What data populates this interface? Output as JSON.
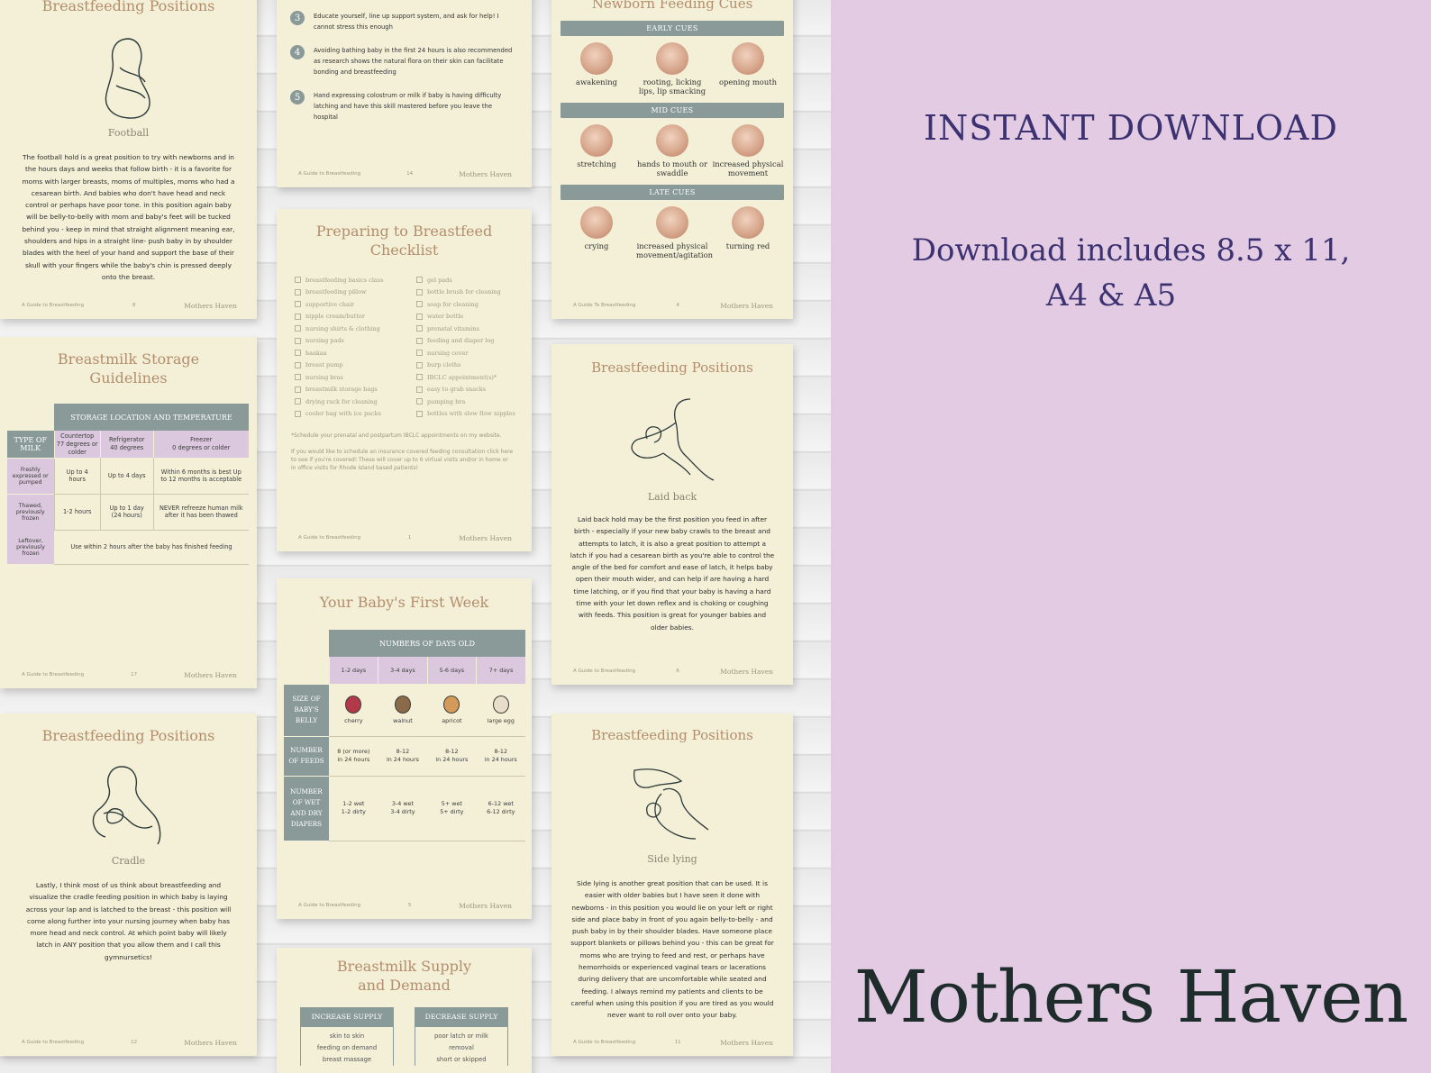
{
  "side_panel": {
    "heading": "INSTANT DOWNLOAD",
    "includes_line1": "Download includes 8.5 x 11,",
    "includes_line2": "A4 & A5",
    "brand": "Mothers Haven",
    "background_color": "#e3cce3",
    "heading_color": "#3c3272"
  },
  "footer_common": {
    "left": "A Guide to Breastfeeding",
    "left_alt": "A Guide To Breastfeeding",
    "brand": "Mothers Haven"
  },
  "football": {
    "title": "Breastfeeding Positions",
    "position_name": "Football",
    "description": "The football hold is a great position to try with newborns and in the hours days and weeks that follow birth - it is a favorite for moms with larger breasts, moms of multiples, moms who had a cesarean birth. And babies who don't have head and neck control or perhaps have poor tone. in this position again baby will be belly-to-belly with mom and baby's feet will be tucked behind you - keep in mind that straight alignment meaning ear, shoulders and hips in a straight line- push baby in by shoulder blades with the heel of your hand and support the base of their skull with your fingers while the baby's chin is pressed deeply onto the breast.",
    "page_number": "8"
  },
  "steps_page": {
    "steps": [
      {
        "n": "3",
        "text": "Educate yourself, line up support system, and ask for help! I cannot stress this enough"
      },
      {
        "n": "4",
        "text": "Avoiding bathing baby in the first 24 hours is also recommended as research shows the natural flora on their skin can facilitate bonding and breastfeeding"
      },
      {
        "n": "5",
        "text": "Hand expressing colostrum or milk if baby is having difficulty latching and have this skill mastered before you leave the hospital"
      }
    ],
    "page_number": "14"
  },
  "feeding_cues": {
    "title": "Newborn Feeding Cues",
    "groups": [
      {
        "band": "EARLY CUES",
        "cues": [
          "awakening",
          "rooting, licking lips, lip smacking",
          "opening mouth"
        ]
      },
      {
        "band": "MID CUES",
        "cues": [
          "stretching",
          "hands to mouth or swaddle",
          "increased physical movement"
        ]
      },
      {
        "band": "LATE CUES",
        "cues": [
          "crying",
          "increased physical movement/agitation",
          "turning red"
        ]
      }
    ],
    "page_number": "4"
  },
  "storage": {
    "title_line1": "Breastmilk Storage",
    "title_line2": "Guidelines",
    "group_header": "STORAGE LOCATION AND TEMPERATURE",
    "corner": "TYPE OF MILK",
    "columns": [
      {
        "name": "Countertop",
        "temp": "77 degrees or colder"
      },
      {
        "name": "Refrigerator",
        "temp": "40 degrees"
      },
      {
        "name": "Freezer",
        "temp": "0 degrees or colder"
      }
    ],
    "rows": [
      {
        "type": "Freshly expressed or pumped",
        "cells": [
          "Up to 4 hours",
          "Up to 4 days",
          "Within 6 months is best Up to 12 months is acceptable"
        ]
      },
      {
        "type": "Thawed, previously frozen",
        "cells": [
          "1-2 hours",
          "Up to 1 day (24 hours)",
          "NEVER refreeze human milk after it has been thawed"
        ]
      }
    ],
    "leftover_type": "Leftover, previously frozen",
    "leftover_text": "Use within 2 hours after the baby has finished feeding",
    "page_number": "17"
  },
  "checklist": {
    "title_line1": "Preparing to Breastfeed",
    "title_line2": "Checklist",
    "left_items": [
      "breastfeeding basics class",
      "breastfeeding pillow",
      "supportive chair",
      "nipple cream/butter",
      "nursing shirts & clothing",
      "nursing pads",
      "haakaa",
      "breast pump",
      "nursing bras",
      "breastmilk storage bags",
      "drying rack for cleaning",
      "cooler bag with ice packs"
    ],
    "right_items": [
      "gel pads",
      "bottle brush for cleaning",
      "soap for cleaning",
      "water bottle",
      "prenatal vitamins",
      "feeding and diaper log",
      "nursing cover",
      "burp cloths",
      "IBCLC appointment(s)*",
      "easy to grab snacks",
      "pumping bra",
      "bottles with slow flow nipples"
    ],
    "note1": "*Schedule your prenatal and postpartum IBCLC appointments on my website.",
    "note2": "If you would like to schedule an insurance covered feeding consultation click here to see if you're covered! These will cover up to 6 virtual visits and/or in home or in office visits for Rhode Island based patients!",
    "page_number": "1"
  },
  "laid_back": {
    "title": "Breastfeeding Positions",
    "position_name": "Laid back",
    "description": "Laid back hold may be the first position you feed in after birth - especially if your new baby crawls to the breast and attempts to latch, it is also a great position to attempt a latch if you had a cesarean birth as you're able to control the angle of the bed for comfort and ease of latch, it helps baby open their mouth wider, and can help if are having a hard time latching, or if you find that your baby is having a hard time with your let down reflex and is choking or coughing with feeds. This position is great for younger babies and older babies.",
    "page_number": "6"
  },
  "first_week": {
    "title": "Your Baby's First Week",
    "group_header": "NUMBERS OF DAYS OLD",
    "days": [
      "1-2 days",
      "3-4 days",
      "5-6 days",
      "7+ days"
    ],
    "row_labels": [
      "SIZE OF BABY'S BELLY",
      "NUMBER OF FEEDS",
      "NUMBER OF WET AND DRY DIAPERS"
    ],
    "sizes": [
      "cherry",
      "walnut",
      "apricot",
      "large egg"
    ],
    "feeds": [
      [
        "8 (or more)",
        "in 24 hours"
      ],
      [
        "8-12",
        "in 24 hours"
      ],
      [
        "8-12",
        "in 24 hours"
      ],
      [
        "8-12",
        "in 24 hours"
      ]
    ],
    "diapers": [
      [
        "1-2 wet",
        "1-2 dirty"
      ],
      [
        "3-4 wet",
        "3-4 dirty"
      ],
      [
        "5+ wet",
        "5+ dirty"
      ],
      [
        "6-12 wet",
        "6-12 dirty"
      ]
    ],
    "page_number": "5"
  },
  "cradle": {
    "title": "Breastfeeding Positions",
    "position_name": "Cradle",
    "description": "Lastly, I think most of us think about breastfeeding and visualize the cradle feeding position in which baby is laying across your lap and is latched to the breast - this position will come along further into your nursing journey when baby has more head and neck control. At which point baby will likely latch in ANY position that you allow them and I call this gymnursetics!",
    "page_number": "12"
  },
  "supply": {
    "title_line1": "Breastmilk Supply",
    "title_line2": "and Demand",
    "increase_header": "INCREASE SUPPLY",
    "decrease_header": "DECREASE SUPPLY",
    "increase_items": [
      "skin to skin",
      "feeding on demand",
      "breast massage"
    ],
    "decrease_items": [
      "poor latch or milk",
      "removal",
      "short or skipped"
    ]
  },
  "side_lying": {
    "title": "Breastfeeding Positions",
    "position_name": "Side lying",
    "description": "Side lying is another great position that can be used. It is easier with older babies but I have seen it done with newborns - in this position you would lie on your left or right side and place baby in front of you again belly-to-belly - and push baby in by their shoulder blades. Have someone place support blankets or pillows behind you - this can be great for moms who are trying to feed and rest, or perhaps have hemorrhoids or experienced vaginal tears or lacerations during delivery that are uncomfortable while seated and feeding. I always remind my patients and clients to be careful when using this position if you are tired as you would never want to roll over onto your baby.",
    "page_number": "11"
  }
}
